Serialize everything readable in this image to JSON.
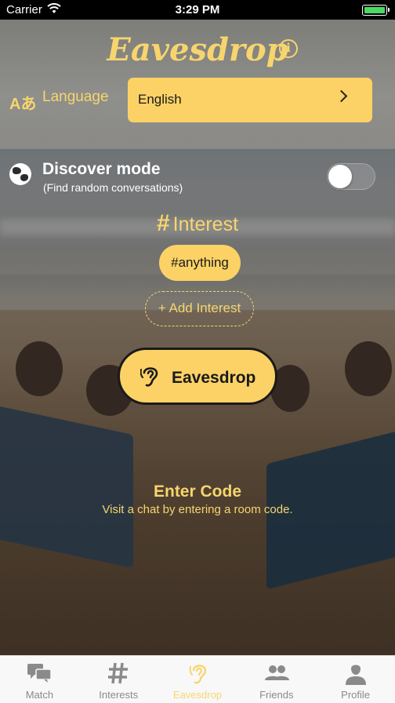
{
  "status_bar": {
    "carrier": "Carrier",
    "time": "3:29 PM"
  },
  "header": {
    "title": "Eavesdrop"
  },
  "language": {
    "label": "Language",
    "value": "English"
  },
  "discover": {
    "title": "Discover mode",
    "subtitle": "(Find random conversations)",
    "enabled": false
  },
  "interest": {
    "title": "Interest",
    "chips": [
      "#anything"
    ],
    "add_label": "+ Add Interest"
  },
  "eavesdrop_button": {
    "label": "Eavesdrop"
  },
  "enter_code": {
    "title": "Enter Code",
    "subtitle": "Visit a chat by entering a room code."
  },
  "tabs": [
    {
      "label": "Match",
      "icon": "chat-bubbles-icon",
      "active": false
    },
    {
      "label": "Interests",
      "icon": "hashtag-icon",
      "active": false
    },
    {
      "label": "Eavesdrop",
      "icon": "ear-icon",
      "active": true
    },
    {
      "label": "Friends",
      "icon": "people-icon",
      "active": false
    },
    {
      "label": "Profile",
      "icon": "person-icon",
      "active": false
    }
  ],
  "colors": {
    "accent": "#fcd266",
    "accent_text": "#f7d56e",
    "tab_inactive": "#8a8a8a"
  }
}
